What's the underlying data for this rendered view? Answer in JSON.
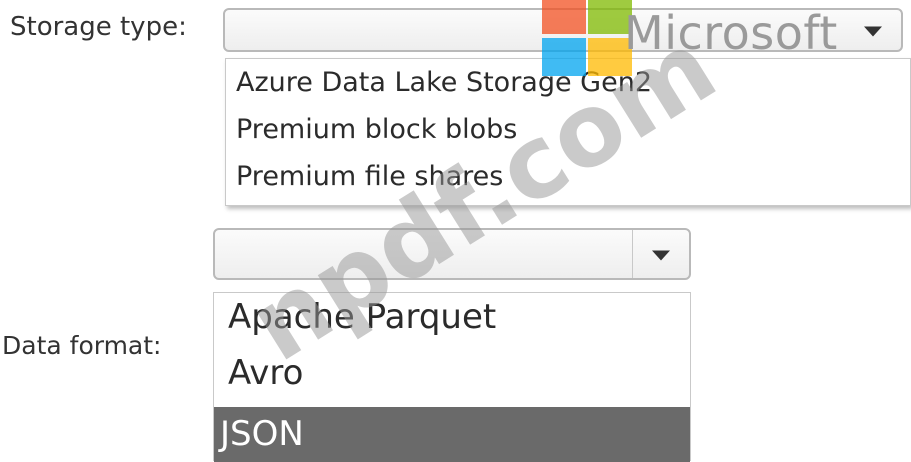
{
  "storage_type": {
    "label": "Storage type:",
    "selected": "",
    "options": [
      "Azure Data Lake Storage Gen2",
      "Premium block blobs",
      "Premium file shares"
    ]
  },
  "data_format": {
    "label": "Data format:",
    "selected": "",
    "options": [
      "Apache Parquet",
      "Avro",
      "JSON"
    ],
    "highlighted_option": "JSON"
  },
  "watermark": {
    "brand": "Microsoft",
    "site": "npdf.com"
  },
  "colors": {
    "highlight": "#6a6a6a",
    "logo_red": "#f25022",
    "logo_green": "#7fba00",
    "logo_blue": "#00a4ef",
    "logo_yellow": "#ffb900"
  }
}
